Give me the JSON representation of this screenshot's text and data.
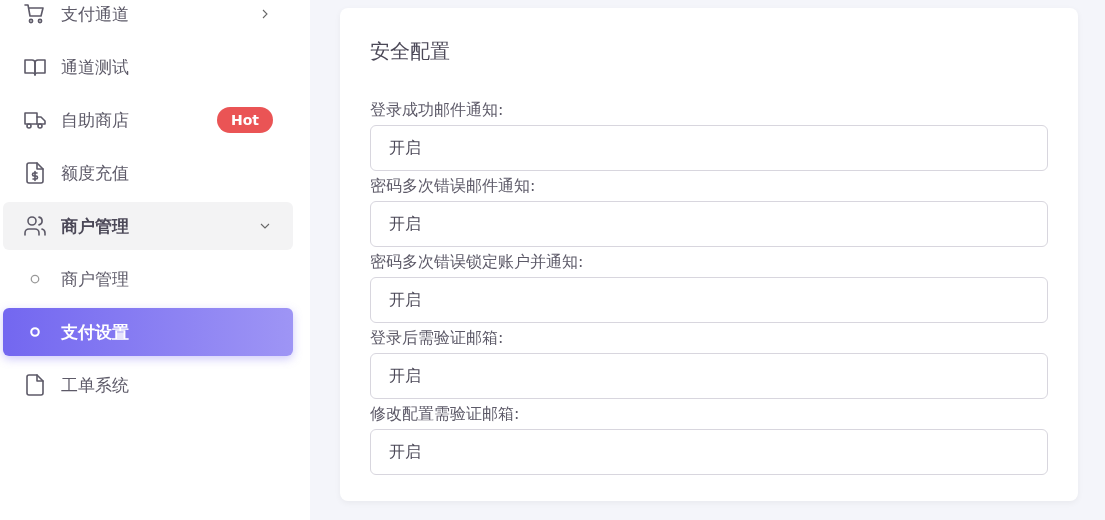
{
  "sidebar": {
    "items": [
      {
        "label": "支付通道",
        "kind": "group",
        "expanded": false,
        "selected": false
      },
      {
        "label": "通道测试",
        "kind": "link",
        "selected": false
      },
      {
        "label": "自助商店",
        "kind": "link",
        "selected": false,
        "badge": "Hot"
      },
      {
        "label": "额度充值",
        "kind": "link",
        "selected": false
      },
      {
        "label": "商户管理",
        "kind": "group",
        "expanded": true,
        "selected": false
      },
      {
        "label": "商户管理",
        "kind": "sub",
        "selected": false
      },
      {
        "label": "支付设置",
        "kind": "sub",
        "selected": true
      },
      {
        "label": "工单系统",
        "kind": "link",
        "selected": false
      }
    ]
  },
  "card": {
    "title": "安全配置",
    "fields": [
      {
        "label": "登录成功邮件通知:",
        "value": "开启"
      },
      {
        "label": "密码多次错误邮件通知:",
        "value": "开启"
      },
      {
        "label": "密码多次错误锁定账户并通知:",
        "value": "开启"
      },
      {
        "label": "登录后需验证邮箱:",
        "value": "开启"
      },
      {
        "label": "修改配置需验证邮箱:",
        "value": "开启"
      }
    ]
  }
}
